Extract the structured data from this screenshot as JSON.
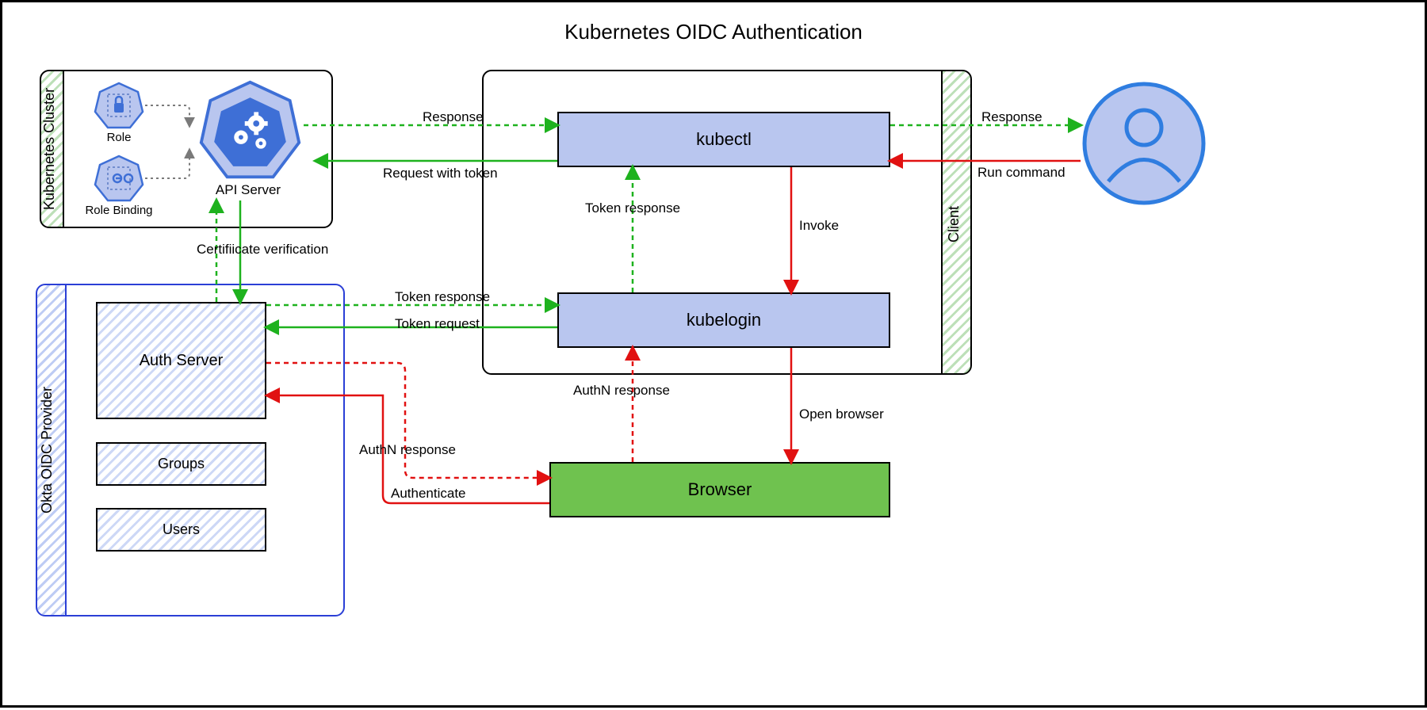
{
  "title": "Kubernetes OIDC Authentication",
  "clusters": {
    "k8s": {
      "label": "Kubernetes Cluster"
    },
    "client": {
      "label": "Client"
    },
    "okta": {
      "label": "Okta OIDC Provider"
    }
  },
  "nodes": {
    "role": "Role",
    "rolebinding": "Role Binding",
    "apiserver": "API Server",
    "kubectl": "kubectl",
    "kubelogin": "kubelogin",
    "browser": "Browser",
    "authserver": "Auth Server",
    "groups": "Groups",
    "users": "Users"
  },
  "edges": {
    "run_command": "Run command",
    "response_user": "Response",
    "response_api": "Response",
    "request_with_token": "Request with token",
    "invoke": "Invoke",
    "token_response_kubectl": "Token response",
    "open_browser": "Open browser",
    "authn_response_kubelogin": "AuthN response",
    "authenticate": "Authenticate",
    "authn_response_auth": "AuthN response",
    "token_request": "Token request",
    "token_response_auth": "Token response",
    "cert_verification": "Certifiicate verification"
  },
  "colors": {
    "green": "#1eb21e",
    "red": "#e11111",
    "blue": "#2b3fd6",
    "k8s_blue": "#3e6fd6",
    "node_fill_blue": "#b9c6ef",
    "node_fill_green": "#6fc24f",
    "user_blue": "#2f7de0",
    "user_fill": "#b9c6ef"
  }
}
